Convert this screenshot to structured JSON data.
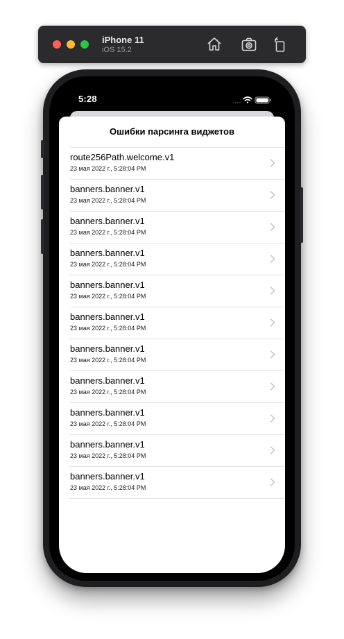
{
  "simulator": {
    "device_name": "iPhone 11",
    "os_version": "iOS 15.2",
    "buttons": [
      {
        "icon": "home-icon"
      },
      {
        "icon": "camera-icon"
      },
      {
        "icon": "rotate-icon"
      }
    ]
  },
  "status_bar": {
    "time": "5:28"
  },
  "sheet": {
    "title": "Ошибки парсинга виджетов"
  },
  "rows": [
    {
      "title": "route256Path.welcome.v1",
      "subtitle": "23 мая 2022 г., 5:28:04 PM"
    },
    {
      "title": "banners.banner.v1",
      "subtitle": "23 мая 2022 г., 5:28:04 PM"
    },
    {
      "title": "banners.banner.v1",
      "subtitle": "23 мая 2022 г., 5:28:04 PM"
    },
    {
      "title": "banners.banner.v1",
      "subtitle": "23 мая 2022 г., 5:28:04 PM"
    },
    {
      "title": "banners.banner.v1",
      "subtitle": "23 мая 2022 г., 5:28:04 PM"
    },
    {
      "title": "banners.banner.v1",
      "subtitle": "23 мая 2022 г., 5:28:04 PM"
    },
    {
      "title": "banners.banner.v1",
      "subtitle": "23 мая 2022 г., 5:28:04 PM"
    },
    {
      "title": "banners.banner.v1",
      "subtitle": "23 мая 2022 г., 5:28:04 PM"
    },
    {
      "title": "banners.banner.v1",
      "subtitle": "23 мая 2022 г., 5:28:04 PM"
    },
    {
      "title": "banners.banner.v1",
      "subtitle": "23 мая 2022 г., 5:28:04 PM"
    },
    {
      "title": "banners.banner.v1",
      "subtitle": "23 мая 2022 г., 5:28:04 PM"
    }
  ],
  "colors": {
    "simulator_bar": "#2b2b2d",
    "close": "#ff5f57",
    "minimize": "#febc2e",
    "zoom": "#28c840",
    "separator": "#e3e3e6",
    "chevron": "#c4c4c7"
  }
}
